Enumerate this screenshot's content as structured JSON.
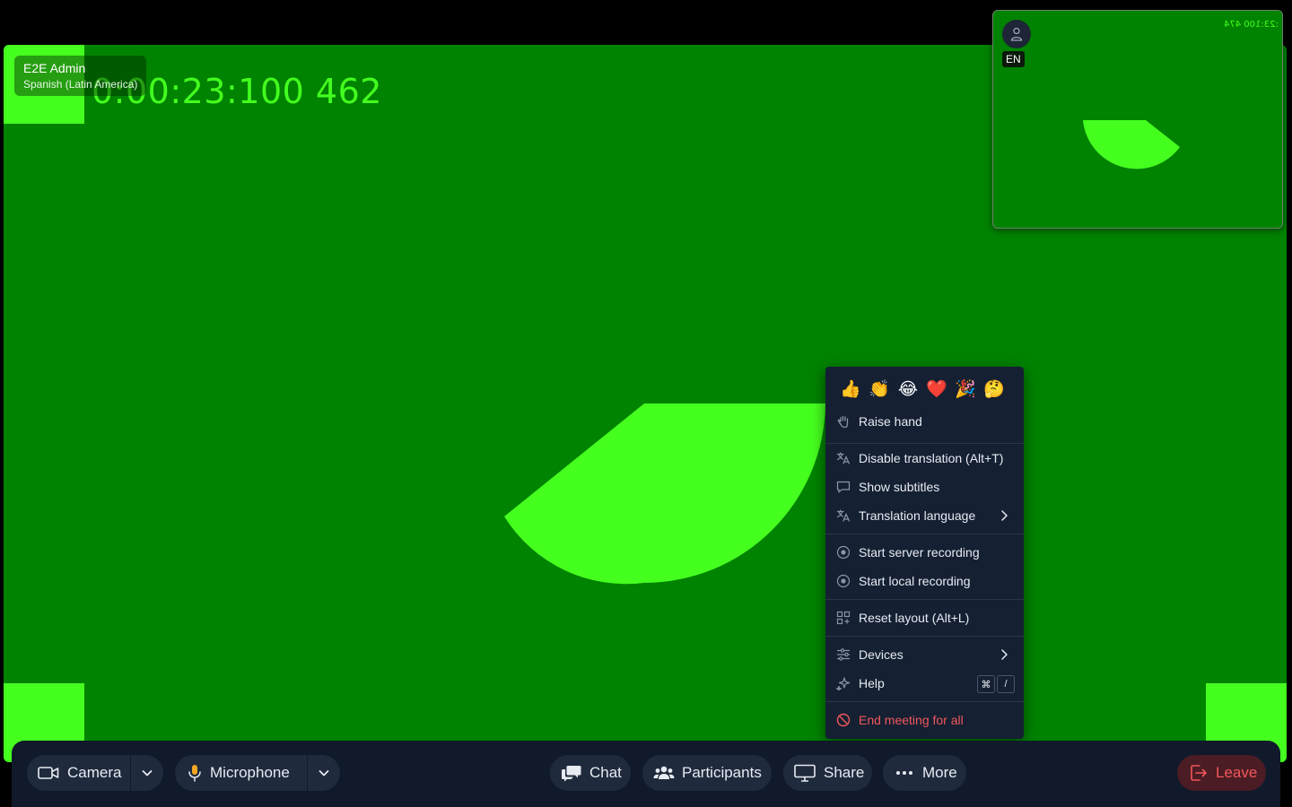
{
  "stage": {
    "timer_text": "0:00:23:100 462",
    "participant_name": "E2E Admin",
    "participant_language": "Spanish (Latin America)"
  },
  "selfview": {
    "language_badge": "EN",
    "mirrored_timer": ":23:100 474",
    "avatar_icon": "user-icon"
  },
  "menu": {
    "reactions": [
      "👍",
      "👏",
      "😂",
      "❤️",
      "🎉",
      "🤔"
    ],
    "raise_hand": "Raise hand",
    "disable_translation": "Disable translation (Alt+T)",
    "show_subtitles": "Show subtitles",
    "translation_language": "Translation language",
    "start_server_recording": "Start server recording",
    "start_local_recording": "Start local recording",
    "reset_layout": "Reset layout (Alt+L)",
    "devices": "Devices",
    "help": "Help",
    "help_key_1": "⌘",
    "help_key_2": "/",
    "end_meeting": "End meeting for all"
  },
  "toolbar": {
    "camera": "Camera",
    "microphone": "Microphone",
    "chat": "Chat",
    "participants": "Participants",
    "share": "Share",
    "more": "More",
    "leave": "Leave"
  },
  "colors": {
    "video_green": "#008300",
    "bright_green": "#45ff1f",
    "menu_bg": "#152033",
    "toolbar_bg": "#101a2b",
    "button_bg": "#1f2a3d",
    "danger": "#f0575a",
    "mic_accent": "#f5a623"
  }
}
